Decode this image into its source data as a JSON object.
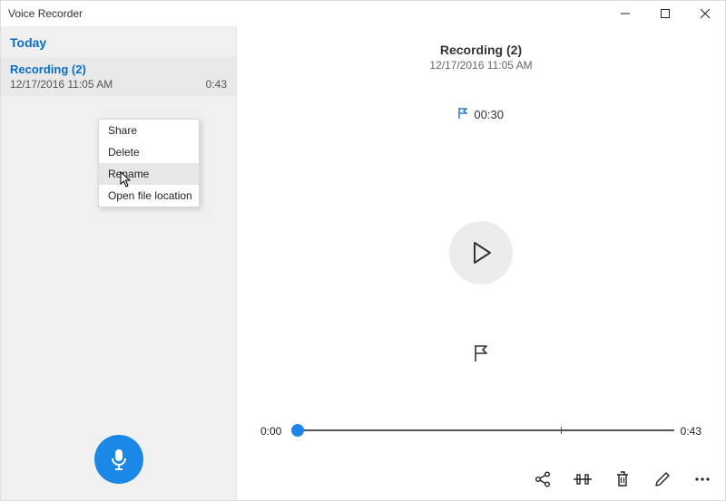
{
  "titlebar": {
    "app_name": "Voice Recorder"
  },
  "sidebar": {
    "section_label": "Today",
    "items": [
      {
        "title": "Recording (2)",
        "timestamp": "12/17/2016 11:05 AM",
        "duration": "0:43"
      }
    ]
  },
  "context_menu": {
    "items": [
      "Share",
      "Delete",
      "Rename",
      "Open file location"
    ],
    "hovered_index": 2
  },
  "main": {
    "title": "Recording (2)",
    "subtitle": "12/17/2016 11:05 AM",
    "marker_time": "00:30",
    "slider_start": "0:00",
    "slider_end": "0:43",
    "marker_fraction": 0.7
  },
  "colors": {
    "accent": "#0a6ec5",
    "button_blue": "#1b87e6"
  }
}
